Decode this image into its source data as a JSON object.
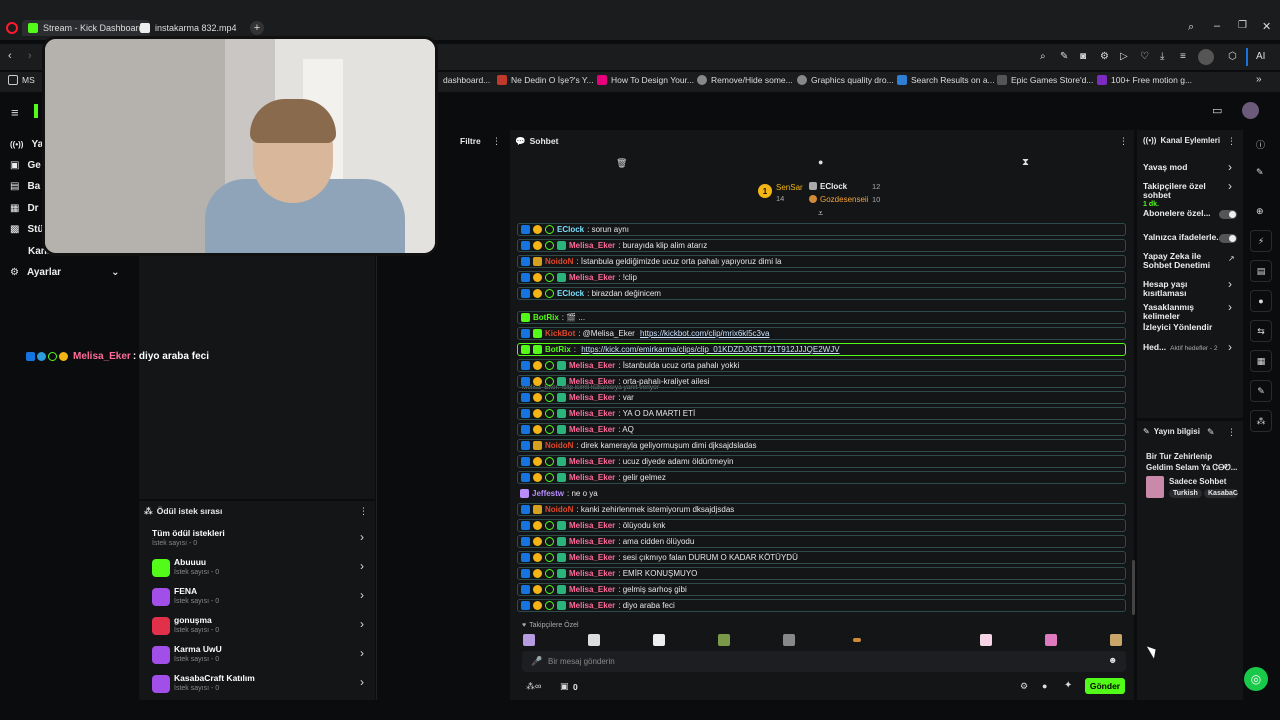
{
  "browser": {
    "tabs": [
      {
        "label": "Stream - Kick Dashboard",
        "active": true
      },
      {
        "label": "instakarma 832.mp4",
        "active": false
      }
    ],
    "bookmarks": [
      "MS",
      "dashboard...",
      "Ne Dedin O İşe?'s Y...",
      "How To Design Your...",
      "Remove/Hide some...",
      "Graphics quality dro...",
      "Search Results on a...",
      "Epic Games Store'd...",
      "100+ Free motion g..."
    ],
    "ai_label": "AI"
  },
  "sidenav": {
    "items": [
      "Ya",
      "Ge",
      "Ba",
      "Dr",
      "Stü",
      "Kanal",
      "Ayarlar"
    ]
  },
  "overlay_message": {
    "user": "Melisa_Eker",
    "text": ": diyo araba feci"
  },
  "filter_panel": {
    "title": "Filtre"
  },
  "chat": {
    "title": "Sohbet",
    "leaderboard": [
      {
        "name": "SenSar",
        "count": "14"
      },
      {
        "name": "EClock",
        "count": "12"
      },
      {
        "name": "Gozdesenseii",
        "count": "10"
      }
    ],
    "messages": [
      {
        "user": "EClock",
        "color": "#7ae0ff",
        "text": ": sorun aynı",
        "badges": [
          "mod",
          "sub",
          "ver"
        ]
      },
      {
        "user": "Melisa_Eker",
        "color": "#ff6b9a",
        "text": ": burayıda klip alim atarız",
        "badges": [
          "mod",
          "sub",
          "ver",
          "shield"
        ]
      },
      {
        "user": "NoidoN",
        "color": "#e0482a",
        "text": ": İstanbula geldiğimizde ucuz orta pahalı yapıyoruz dimi la",
        "badges": [
          "mod",
          "crown"
        ]
      },
      {
        "user": "Melisa_Eker",
        "color": "#ff6b9a",
        "text": ": !clip",
        "badges": [
          "mod",
          "sub",
          "ver",
          "shield"
        ]
      },
      {
        "user": "EClock",
        "color": "#7ae0ff",
        "text": ": birazdan değinicem",
        "badges": [
          "mod",
          "sub",
          "ver"
        ]
      },
      {
        "reply": "Melisa_Eker: !clip isimli kullanıcıya yanıt veriyor",
        "user": "BotRix",
        "color": "#53fc18",
        "text": ": 🎬 ...",
        "badges": [
          "grn"
        ]
      },
      {
        "user": "KickBot",
        "color": "#e0482a",
        "text": ": @Melisa_Eker ",
        "link": "https://kickbot.com/clip/mrix6kl5c3va",
        "badges": [
          "mod",
          "grn"
        ]
      },
      {
        "user": "BotRix",
        "color": "#53fc18",
        "text": ": ",
        "link": "https://kick.com/emirkarma/clips/clip_01KDZDJ0STT21T912JJJQE2WJV",
        "badges": [
          "grn",
          "grn"
        ],
        "highlight": true
      },
      {
        "user": "Melisa_Eker",
        "color": "#ff6b9a",
        "text": ": İstanbulda ucuz orta pahalı yokki",
        "badges": [
          "mod",
          "sub",
          "ver",
          "shield"
        ]
      },
      {
        "user": "Melisa_Eker",
        "color": "#ff6b9a",
        "text": ": orta-pahalı-kraliyet ailesi",
        "badges": [
          "mod",
          "sub",
          "ver",
          "shield"
        ]
      },
      {
        "user": "Melisa_Eker",
        "color": "#ff6b9a",
        "text": ": var",
        "badges": [
          "mod",
          "sub",
          "ver",
          "shield"
        ]
      },
      {
        "user": "Melisa_Eker",
        "color": "#ff6b9a",
        "text": ": YA O DA MARTI ETİ",
        "badges": [
          "mod",
          "sub",
          "ver",
          "shield"
        ]
      },
      {
        "user": "Melisa_Eker",
        "color": "#ff6b9a",
        "text": ": AQ",
        "badges": [
          "mod",
          "sub",
          "ver",
          "shield"
        ]
      },
      {
        "user": "NoidoN",
        "color": "#e0482a",
        "text": ": direk kamerayla geliyormuşum dimi djksajdsladas",
        "badges": [
          "mod",
          "crown"
        ]
      },
      {
        "user": "Melisa_Eker",
        "color": "#ff6b9a",
        "text": ": ucuz diyede adamı öldürtmeyin",
        "badges": [
          "mod",
          "sub",
          "ver",
          "shield"
        ]
      },
      {
        "user": "Melisa_Eker",
        "color": "#ff6b9a",
        "text": ": gelir gelmez",
        "badges": [
          "mod",
          "sub",
          "ver",
          "shield"
        ]
      },
      {
        "user": "Jeffestw",
        "color": "#b98cff",
        "text": ": ne o ya",
        "badges": [
          "purple"
        ],
        "plain": true
      },
      {
        "user": "NoidoN",
        "color": "#e0482a",
        "text": ": kanki zehirlenmek istemiyorum dksajdjsdas",
        "badges": [
          "mod",
          "crown"
        ]
      },
      {
        "user": "Melisa_Eker",
        "color": "#ff6b9a",
        "text": ": ölüyodu knk",
        "badges": [
          "mod",
          "sub",
          "ver",
          "shield"
        ]
      },
      {
        "user": "Melisa_Eker",
        "color": "#ff6b9a",
        "text": ": ama cidden ölüyodu",
        "badges": [
          "mod",
          "sub",
          "ver",
          "shield"
        ]
      },
      {
        "user": "Melisa_Eker",
        "color": "#ff6b9a",
        "text": ": sesi çıkmıyo falan DURUM O KADAR KÖTÜYDÜ",
        "badges": [
          "mod",
          "sub",
          "ver",
          "shield"
        ]
      },
      {
        "user": "Melisa_Eker",
        "color": "#ff6b9a",
        "text": ": EMİR KONUŞMUYO",
        "badges": [
          "mod",
          "sub",
          "ver",
          "shield"
        ]
      },
      {
        "user": "Melisa_Eker",
        "color": "#ff6b9a",
        "text": ": gelmiş sarhoş gibi",
        "badges": [
          "mod",
          "sub",
          "ver",
          "shield"
        ]
      },
      {
        "user": "Melisa_Eker",
        "color": "#ff6b9a",
        "text": ": diyo araba feci",
        "badges": [
          "mod",
          "sub",
          "ver",
          "shield"
        ]
      }
    ],
    "emote_section": "Takipçilere Özel",
    "input_placeholder": "Bir mesaj gönderin",
    "points": "0",
    "send_label": "Gönder"
  },
  "rewards": {
    "title": "Ödül istek sırası",
    "items": [
      {
        "name": "Tüm ödül istekleri",
        "sub": "İstek sayısı - 0",
        "color": ""
      },
      {
        "name": "Abuuuu",
        "sub": "İstek sayısı - 0",
        "color": "#53fc18"
      },
      {
        "name": "FENA",
        "sub": "İstek sayısı - 0",
        "color": "#a24ee8"
      },
      {
        "name": "gonuşma",
        "sub": "İstek sayısı - 0",
        "color": "#e0304a"
      },
      {
        "name": "Karma UwU",
        "sub": "İstek sayısı - 0",
        "color": "#a24ee8"
      },
      {
        "name": "KasabaCraft Katılım",
        "sub": "İstek sayısı - 0",
        "color": "#a24ee8"
      }
    ]
  },
  "channel_actions": {
    "title": "Kanal Eylemleri",
    "items": [
      {
        "label": "Yavaş mod",
        "control": "chevron"
      },
      {
        "label": "Takipçilere özel sohbet",
        "sub": "1 dk.",
        "control": "chevron"
      },
      {
        "label": "Abonelere özel...",
        "control": "toggle"
      },
      {
        "label": "Yalnızca ifadelerle...",
        "control": "toggle"
      },
      {
        "label": "Yapay Zeka ile Sohbet Denetimi",
        "control": "link"
      },
      {
        "label": "Hesap yaşı kısıtlaması",
        "control": "chevron"
      },
      {
        "label": "Yasaklanmış kelimeler",
        "control": "chevron"
      },
      {
        "label": "İzleyici Yönlendir",
        "control": "none"
      },
      {
        "label": "Hed...",
        "sub": "Aktif hedefler - 2",
        "control": "chevron"
      }
    ]
  },
  "stream_info": {
    "title": "Yayın bilgisi",
    "stream_title": "Bir Tur Zehirlenip Geldim Selam Ya ᏣᎾᏬ...",
    "category": "Sadece Sohbet",
    "tags": [
      "Turkish",
      "KasabaC"
    ]
  },
  "colors": {
    "accent": "#53fc18",
    "panel": "#141517",
    "bg": "#0b0c0e"
  }
}
